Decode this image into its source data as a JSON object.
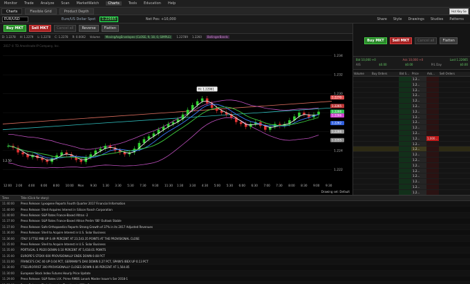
{
  "menu": {
    "items": [
      "Monitor",
      "Trade",
      "Analyze",
      "Scan",
      "MarketWatch",
      "Charts",
      "Tools",
      "Education",
      "Help"
    ],
    "active_index": 5
  },
  "tabs": {
    "items": [
      "Charts",
      "Flexible Grid",
      "Product Depth"
    ]
  },
  "tooltip": "Hot Key Se",
  "symbol_bar": {
    "symbol": "EUR/USD",
    "subtitle": "Euro/US Dollar Spot",
    "last_price": "1.22665",
    "net_position": "Net Pos: +10,000",
    "right_items": [
      "Share",
      "Style",
      "Drawings",
      "Studies",
      "Patterns"
    ]
  },
  "order_bar": {
    "buy": "Buy MKT",
    "sell": "Sell MKT",
    "cancel_all": "Cancel all",
    "reverse": "Reverse",
    "flatten": "Flatten"
  },
  "chart_header": {
    "items": [
      "D: 1.2278",
      "H: 1.2279",
      "L: 1.2278",
      "C: 1.2278",
      "R: 0.0002",
      "Volume"
    ],
    "study1": "MovingAvgEnvelopes (CLOSE, 9, 18, 0, SIMPLE)",
    "study1_values": [
      "1.22789",
      "1.2260"
    ],
    "study2": "BollingerBands"
  },
  "chart_data": {
    "type": "line",
    "symbol_label": "EUR/USD (EUR) 5 D 5m",
    "watermark": "2017 © TD Ameritrade IP Company, Inc.",
    "x_ticks": [
      "12:00",
      "2:00",
      "4:00",
      "6:00",
      "8:00",
      "10:00",
      "Mon",
      "9:30",
      "1:30",
      "3:30",
      "5:30",
      "7:30",
      "9:30",
      "11:30",
      "1:30",
      "3:30",
      "4:30",
      "5:00",
      "5:30",
      "6:00",
      "6:30",
      "7:00",
      "7:30",
      "8:00",
      "8:30",
      "9:00",
      "9:30"
    ],
    "y_ticks": [
      "1.234",
      "1.232",
      "1.230",
      "1.228",
      "1.226",
      "1.224",
      "1.222"
    ],
    "ylim": [
      1.221,
      1.235
    ],
    "hi_label": "Hi: 1.22961",
    "price_tags": [
      {
        "label": "1.2270",
        "color": "#e05050",
        "value": 1.2296
      },
      {
        "label": "1.2265",
        "color": "#c03838",
        "value": 1.2287
      },
      {
        "label": "1.2266",
        "color": "#30c050",
        "value": 1.2281
      },
      {
        "label": "1.2266",
        "color": "#d040d0",
        "value": 1.2277
      },
      {
        "label": "1.2262",
        "color": "#3060e0",
        "value": 1.2269
      },
      {
        "label": "1.2266",
        "color": "#9a9a9a",
        "value": 1.226
      },
      {
        "label": "1.2255",
        "color": "#8a8a8a",
        "value": 1.2251
      }
    ],
    "series": [
      {
        "kind": "candles",
        "values": [
          1.2245,
          1.2243,
          1.2238,
          1.2236,
          1.2233,
          1.2235,
          1.2232,
          1.223,
          1.2228,
          1.2232,
          1.2235,
          1.2238,
          1.2236,
          1.2233,
          1.223,
          1.2228,
          1.2233,
          1.2236,
          1.224,
          1.2242,
          1.2245,
          1.2243,
          1.224,
          1.2238,
          1.2236,
          1.2238,
          1.2242,
          1.2248,
          1.2252,
          1.2255,
          1.2258,
          1.2262,
          1.2265,
          1.2268,
          1.227,
          1.2273,
          1.2278,
          1.2283,
          1.2288,
          1.2292,
          1.2295,
          1.229,
          1.2285,
          1.2282,
          1.228,
          1.2278,
          1.2275,
          1.227,
          1.2268,
          1.2265,
          1.2268,
          1.227,
          1.2266,
          1.2262,
          1.2265,
          1.2268,
          1.2266,
          1.2268,
          1.2272,
          1.2276,
          1.228,
          1.2278,
          1.2275,
          1.2278,
          1.2281
        ]
      },
      {
        "kind": "ma",
        "color": "#f0f0f0"
      },
      {
        "kind": "ma",
        "color": "#3c7cff"
      },
      {
        "kind": "ma",
        "color": "#40d040"
      },
      {
        "kind": "band",
        "color": "#c050c0"
      },
      {
        "kind": "trend",
        "color": "#e07060",
        "values": [
          1.2268,
          1.2292
        ]
      },
      {
        "kind": "trend",
        "color": "#30c0c0",
        "values": [
          1.2262,
          1.2285
        ]
      }
    ],
    "cursor_label": "1.2.50",
    "drawing_set": "Drawing set: Default"
  },
  "right_panel": {
    "buy": "Buy MKT",
    "sell": "Sell MKT",
    "cancel_all": "Cancel all",
    "flatten": "Flatten",
    "quote_rows": [
      [
        "Bid 10,000 +0",
        "Ask 10,000 +0",
        "Last 1.22665"
      ],
      [
        "A/S",
        "$0.00",
        "$0.00",
        "P/L Day",
        "$0.00"
      ]
    ],
    "ladder_columns": [
      "Volume",
      "Buy Orders",
      "Bid S...",
      "Price",
      "Ask...",
      "Sell Orders"
    ],
    "ladder_rows": [
      {
        "price": "1.2...",
        "bid": "",
        "ask": ""
      },
      {
        "price": "1.2...",
        "bid": "",
        "ask": ""
      },
      {
        "price": "1.2...",
        "bid": "",
        "ask": ""
      },
      {
        "price": "1.2...",
        "bid": "",
        "ask": ""
      },
      {
        "price": "1.2...",
        "bid": "",
        "ask": ""
      },
      {
        "price": "1.2...",
        "bid": "",
        "ask": ""
      },
      {
        "price": "1.2...",
        "bid": "",
        "ask": ""
      },
      {
        "price": "1.2...",
        "bid": "",
        "ask": ""
      },
      {
        "price": "1.2...",
        "bid": "",
        "ask": ""
      },
      {
        "price": "1.2...",
        "bid": "",
        "ask": ""
      },
      {
        "price": "1.2...",
        "bid": "",
        "ask": ""
      },
      {
        "price": "1.2...",
        "bid": "",
        "ask": "1,000..."
      },
      {
        "price": "1.2...",
        "bid": "",
        "ask": ""
      },
      {
        "price": "1.2...",
        "bid": "",
        "ask": ""
      },
      {
        "price": "1.2...",
        "bid": "",
        "ask": ""
      },
      {
        "price": "1.2...",
        "bid": "",
        "ask": ""
      },
      {
        "price": "1.2...",
        "bid": "",
        "ask": ""
      },
      {
        "price": "1.2...",
        "bid": "",
        "ask": ""
      },
      {
        "price": "1.2...",
        "bid": "",
        "ask": ""
      },
      {
        "price": "1.2...",
        "bid": "",
        "ask": ""
      },
      {
        "price": "1.2...",
        "bid": "",
        "ask": ""
      },
      {
        "price": "1.2...",
        "bid": "",
        "ask": ""
      }
    ],
    "highlight_row": 13,
    "ask_row": 11
  },
  "news": {
    "columns": [
      "Time",
      "Title (Click for story)"
    ],
    "rows": [
      {
        "time": "11:40:00",
        "title": "Press Release: Lyxogene Reports Fourth Quarter 2017 Financial Information"
      },
      {
        "time": "11:40:00",
        "title": "Press Release: Shell Acquires Interest in Silicon Ranch Corporation"
      },
      {
        "time": "11:40:00",
        "title": "Press Release: S&P Rates France-Based Altran -2"
      },
      {
        "time": "11:37:00",
        "title": "Press Release: S&P Rates France-Based Altran Prelim 'BB' Outlook Stable"
      },
      {
        "time": "11:37:00",
        "title": "Press Release: Safe Orthopaedics Reports Strong Growth of 37% in its 2017 Adjusted Revenues"
      },
      {
        "time": "11:36:00",
        "title": "Press Release: Shell to Acquire Interest in U.S. Solar Business"
      },
      {
        "time": "11:36:00",
        "title": "ITALY  S FTSE MIB  UP 0.49 PERCENT AT 23,543.35 POINTS AT THE PROVISIONAL CLOSE"
      },
      {
        "time": "11:35:00",
        "title": "Press Release: Shell to Acquire Interest in U.S. Solar Business"
      },
      {
        "time": "11:35:00",
        "title": "PORTUGAL  S PSI20  DOWN 0.10 PERCENT AT 5,618.01 POINTS"
      },
      {
        "time": "11:35:00",
        "title": "EUROPE'S STOXX 600  PROVISIONALLY ENDS DOWN 0.08 PCT"
      },
      {
        "time": "11:31:00",
        "title": "FRANCE'S CAC 40  UP 0.04 PCT, GERMANY'S DAX  DOWN 0.27 PCT, SPAIN'S IBEX  UP 0.13 PCT"
      },
      {
        "time": "11:30:00",
        "title": "FTSEUROFIRST 300  PROVISIONALLY CLOSES DOWN 0.06 PERCENT AT 1,564.85"
      },
      {
        "time": "11:30:00",
        "title": "European Stock Index Futures Hourly Price Update"
      },
      {
        "time": "11:29:00",
        "title": "Press Release: S&P Rates U.K. Prime RMBS Lanark Master Issuer's Ser 2018-1"
      },
      {
        "time": "11:25:00",
        "title": "Press Release: Fitch Upgrades Together to 'BB'; -2"
      },
      {
        "time": "11:25:00",
        "title": "Press Release: Fitch Upgrades Together to 'BB'; Stable Outlook"
      }
    ]
  }
}
